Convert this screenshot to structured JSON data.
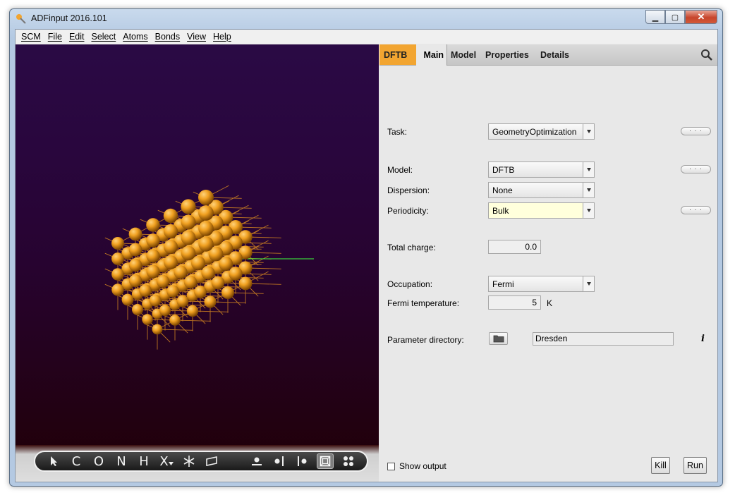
{
  "window": {
    "title": "ADFinput 2016.101",
    "close_glyph": "✕",
    "min_glyph": "▁",
    "max_glyph": "▢"
  },
  "menu": [
    "SCM",
    "File",
    "Edit",
    "Select",
    "Atoms",
    "Bonds",
    "View",
    "Help"
  ],
  "tabs": {
    "engine": "DFTB",
    "main": "Main",
    "model": "Model",
    "properties": "Properties",
    "details": "Details"
  },
  "form": {
    "task": {
      "label": "Task:",
      "value": "GeometryOptimization"
    },
    "model": {
      "label": "Model:",
      "value": "DFTB"
    },
    "dispersion": {
      "label": "Dispersion:",
      "value": "None"
    },
    "periodicity": {
      "label": "Periodicity:",
      "value": "Bulk"
    },
    "total_charge": {
      "label": "Total charge:",
      "value": "0.0"
    },
    "occupation": {
      "label": "Occupation:",
      "value": "Fermi"
    },
    "fermi_temperature": {
      "label": "Fermi temperature:",
      "value": "5",
      "unit": "K"
    },
    "parameter_directory": {
      "label": "Parameter directory:",
      "value": "Dresden"
    },
    "more_label": "· · ·",
    "info_glyph": "i"
  },
  "bottom": {
    "show_output": "Show output",
    "kill": "Kill",
    "run": "Run"
  },
  "viewer_tools": [
    "C",
    "O",
    "N",
    "H",
    "X"
  ],
  "colors": {
    "accent_tab": "#f2a531",
    "atom": "#f0a020",
    "highlight_field": "#ffffdc"
  }
}
